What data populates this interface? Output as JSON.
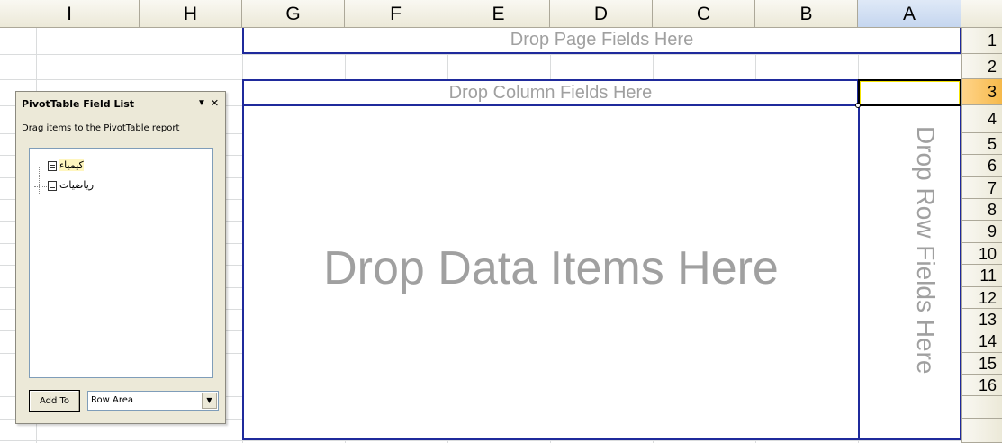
{
  "sheet": {
    "columns": [
      "I",
      "H",
      "G",
      "F",
      "E",
      "D",
      "C",
      "B",
      "A"
    ],
    "selected_column": "A",
    "rows": [
      "1",
      "2",
      "3",
      "4",
      "5",
      "6",
      "7",
      "8",
      "9",
      "10",
      "11",
      "12",
      "13",
      "14",
      "15",
      "16"
    ],
    "selected_row": "3"
  },
  "pivot": {
    "page_area": "Drop Page Fields Here",
    "column_area": "Drop Column Fields Here",
    "data_area": "Drop Data Items Here",
    "row_area": "Drop Row Fields Here"
  },
  "field_list": {
    "title": "PivotTable Field List",
    "dropdown_icon": "▼",
    "close_icon": "×",
    "subtitle": "Drag items to the PivotTable report",
    "fields": [
      {
        "label": "كيمياء",
        "icon": "field-icon"
      },
      {
        "label": "رياضيات",
        "icon": "field-icon"
      }
    ],
    "add_button": "Add To",
    "area_select": "Row Area",
    "area_select_arrow": "▼"
  }
}
